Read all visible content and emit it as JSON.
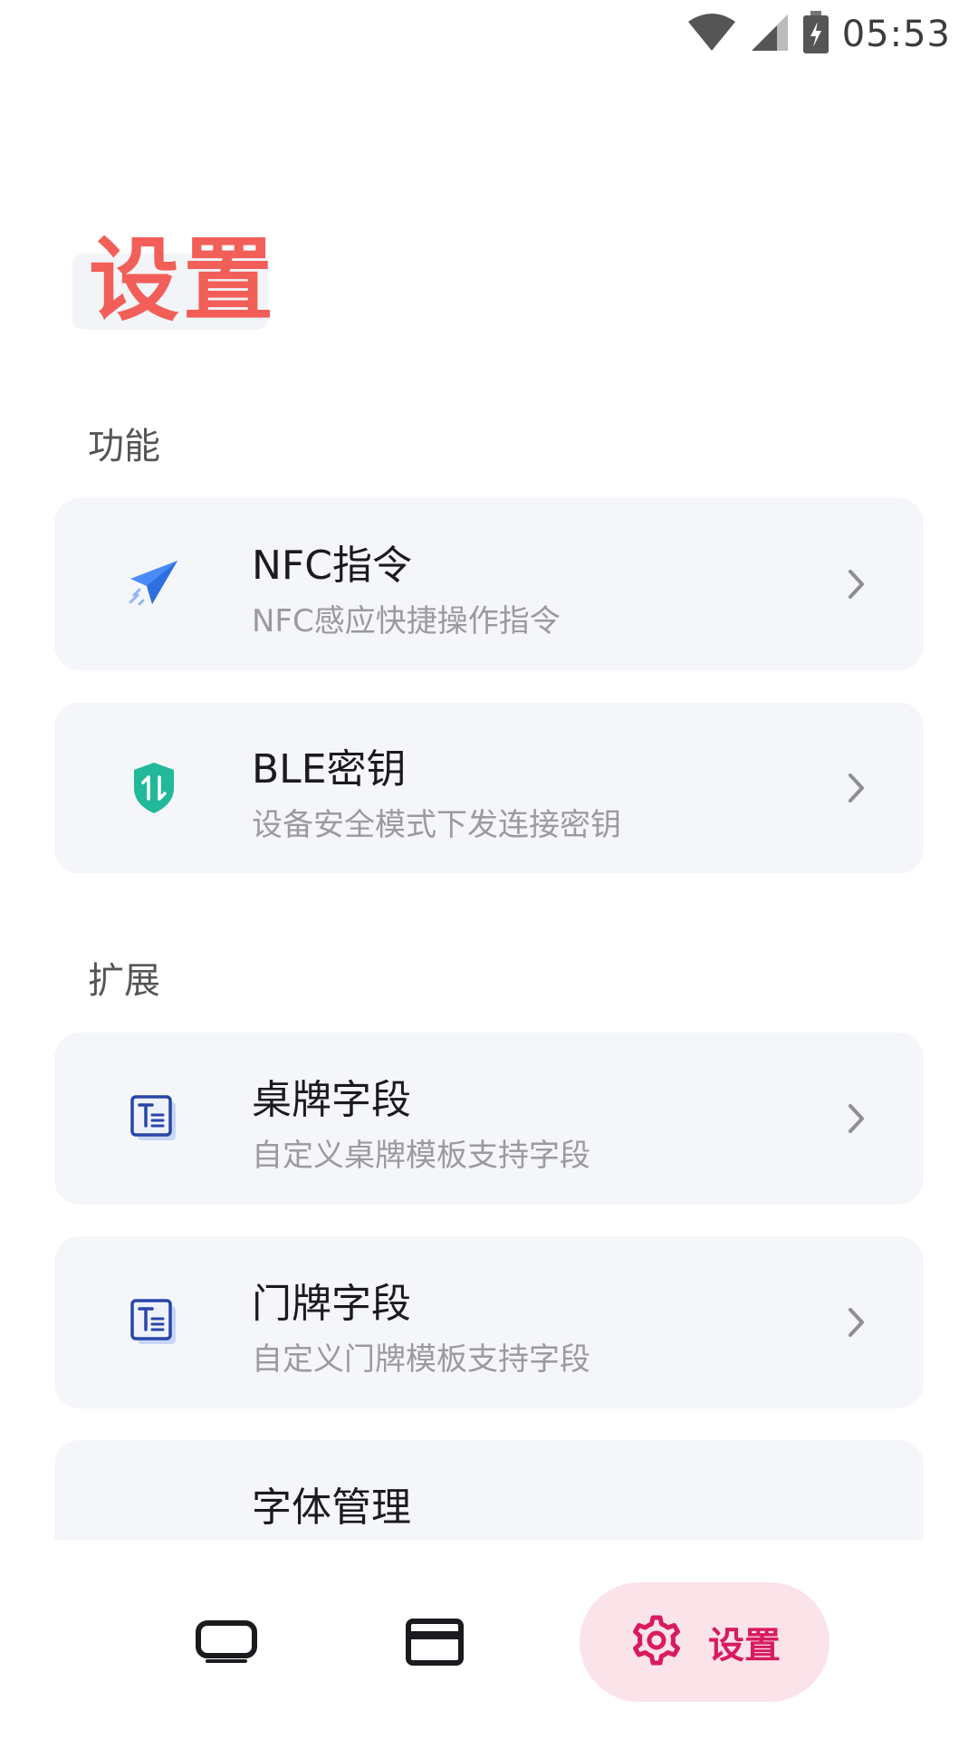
{
  "status_bar": {
    "time": "05:53"
  },
  "page": {
    "title": "设置"
  },
  "sections": [
    {
      "header": "功能",
      "items": [
        {
          "title": "NFC指令",
          "subtitle": "NFC感应快捷操作指令",
          "icon": "paper-plane-icon"
        },
        {
          "title": "BLE密钥",
          "subtitle": "设备安全模式下发连接密钥",
          "icon": "shield-icon"
        }
      ]
    },
    {
      "header": "扩展",
      "items": [
        {
          "title": "桌牌字段",
          "subtitle": "自定义桌牌模板支持字段",
          "icon": "text-field-icon"
        },
        {
          "title": "门牌字段",
          "subtitle": "自定义门牌模板支持字段",
          "icon": "text-field-icon"
        },
        {
          "title": "字体管理",
          "subtitle": "",
          "icon": "font-icon"
        }
      ]
    }
  ],
  "bottom_nav": {
    "items": [
      {
        "icon": "display-icon"
      },
      {
        "icon": "card-icon"
      },
      {
        "icon": "gear-icon",
        "label": "设置",
        "active": true
      }
    ]
  },
  "colors": {
    "accent": "#d81b60",
    "title": "#f25f58",
    "card_bg": "#f4f6fa"
  }
}
